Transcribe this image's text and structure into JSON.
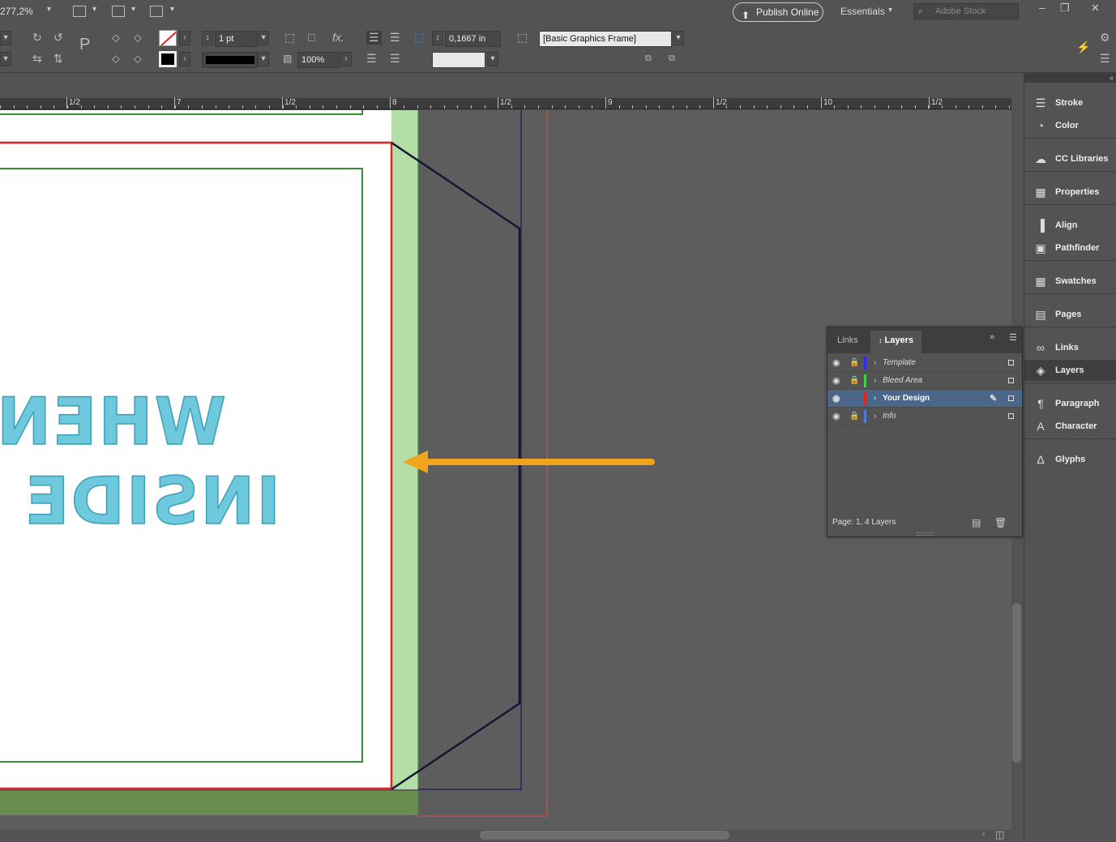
{
  "app": {
    "zoom": "277,2%",
    "publish_label": "Publish Online",
    "workspace": "Essentials",
    "stock_placeholder": "Adobe Stock"
  },
  "control": {
    "stroke_weight": "1 pt",
    "opacity": "100%",
    "corner_size": "0,1667 in",
    "object_style": "[Basic Graphics Frame]"
  },
  "ruler": {
    "labels": [
      "1/2",
      "7",
      "1/2",
      "8",
      "1/2",
      "9",
      "1/2",
      "10",
      "1/2"
    ]
  },
  "artwork": {
    "line1": "WHEN",
    "line2": "INSIDE I",
    "text_color": "#6ec9dd"
  },
  "dock": {
    "items": [
      {
        "label": "Stroke",
        "icon": "stroke-icon"
      },
      {
        "label": "Color",
        "icon": "color-icon"
      },
      {
        "label": "CC Libraries",
        "icon": "cc-libraries-icon"
      },
      {
        "label": "Properties",
        "icon": "properties-icon"
      },
      {
        "label": "Align",
        "icon": "align-icon"
      },
      {
        "label": "Pathfinder",
        "icon": "pathfinder-icon"
      },
      {
        "label": "Swatches",
        "icon": "swatches-icon"
      },
      {
        "label": "Pages",
        "icon": "pages-icon"
      },
      {
        "label": "Links",
        "icon": "links-icon"
      },
      {
        "label": "Layers",
        "icon": "layers-icon"
      },
      {
        "label": "Paragraph",
        "icon": "paragraph-icon"
      },
      {
        "label": "Character",
        "icon": "character-icon"
      },
      {
        "label": "Glyphs",
        "icon": "glyphs-icon"
      }
    ]
  },
  "layers_panel": {
    "tabs": [
      "Links",
      "Layers"
    ],
    "active_tab": "Layers",
    "layers": [
      {
        "name": "Template",
        "color": "#2d2df0",
        "locked": true,
        "selected": false
      },
      {
        "name": "Bleed Area",
        "color": "#3fd24a",
        "locked": true,
        "selected": false
      },
      {
        "name": "Your Design",
        "color": "#e02424",
        "locked": false,
        "selected": true
      },
      {
        "name": "Info",
        "color": "#4a7fd6",
        "locked": true,
        "selected": false
      }
    ],
    "footer": "Page: 1, 4 Layers"
  },
  "colors": {
    "margin_red": "#e02424",
    "guide_green": "#3a8a3a",
    "bleed_fill": "#b3dfa6",
    "arrow": "#f2a51a"
  }
}
